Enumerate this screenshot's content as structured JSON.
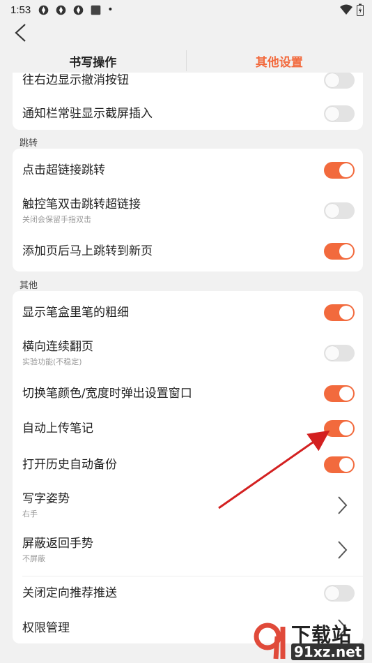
{
  "status_bar": {
    "time": "1:53",
    "dot": "•"
  },
  "tabs": [
    {
      "label": "书写操作",
      "active": false
    },
    {
      "label": "其他设置",
      "active": true
    }
  ],
  "colors": {
    "accent": "#f26a3d",
    "toggle_off": "#e3e3e3",
    "arrow": "#d32020"
  },
  "card1": {
    "rows": [
      {
        "label": "往右边显示撤消按钮",
        "on": false
      },
      {
        "label": "通知栏常驻显示截屏插入",
        "on": false
      }
    ]
  },
  "section_jump": {
    "title": "跳转",
    "rows": [
      {
        "label": "点击超链接跳转",
        "on": true
      },
      {
        "label": "触控笔双击跳转超链接",
        "sub": "关闭会保留手指双击",
        "on": false
      },
      {
        "label": "添加页后马上跳转到新页",
        "on": true
      }
    ]
  },
  "section_other": {
    "title": "其他",
    "rows": [
      {
        "label": "显示笔盒里笔的粗细",
        "on": true
      },
      {
        "label": "横向连续翻页",
        "sub": "实验功能(不稳定)",
        "on": false
      },
      {
        "label": "切换笔颜色/宽度时弹出设置窗口",
        "on": true
      },
      {
        "label": "自动上传笔记",
        "on": true
      },
      {
        "label": "打开历史自动备份",
        "on": true
      },
      {
        "label": "写字姿势",
        "sub": "右手",
        "type": "chevron"
      },
      {
        "label": "屏蔽返回手势",
        "sub": "不屏蔽",
        "type": "chevron"
      },
      {
        "label": "关闭定向推荐推送",
        "on": false
      },
      {
        "label": "权限管理",
        "type": "chevron"
      }
    ]
  },
  "watermark": {
    "text1": "下载站",
    "text2": "91xz.net"
  }
}
